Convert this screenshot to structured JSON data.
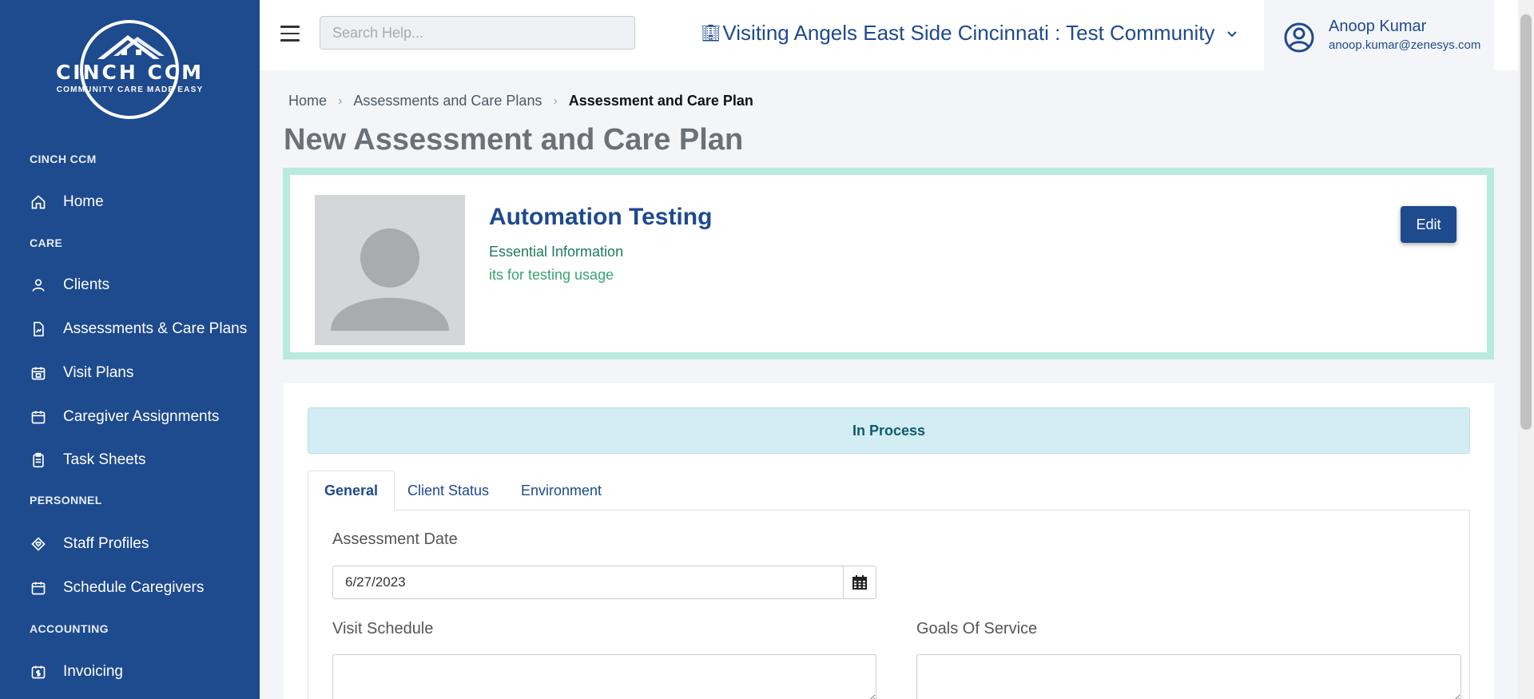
{
  "sidebar": {
    "logo_title": "CINCH CCM",
    "logo_tagline": "COMMUNITY CARE MADE EASY",
    "sections": {
      "cinch": "CINCH CCM",
      "care": "CARE",
      "personnel": "PERSONNEL",
      "accounting": "ACCOUNTING"
    },
    "items": [
      {
        "label": "Home",
        "icon": "home-icon"
      },
      {
        "label": "Clients",
        "icon": "user-icon"
      },
      {
        "label": "Assessments & Care Plans",
        "icon": "document-chart-icon"
      },
      {
        "label": "Visit Plans",
        "icon": "calendar-check-icon"
      },
      {
        "label": "Caregiver Assignments",
        "icon": "calendar-icon"
      },
      {
        "label": "Task Sheets",
        "icon": "clipboard-icon"
      },
      {
        "label": "Staff Profiles",
        "icon": "heart-badge-icon"
      },
      {
        "label": "Schedule Caregivers",
        "icon": "calendar-icon"
      },
      {
        "label": "Invoicing",
        "icon": "dollar-calendar-icon"
      }
    ]
  },
  "topbar": {
    "search_placeholder": "Search Help...",
    "organization": "Visiting Angels East Side Cincinnati : Test Community",
    "user_name": "Anoop Kumar",
    "user_email": "anoop.kumar@zenesys.com"
  },
  "breadcrumb": {
    "home": "Home",
    "parent": "Assessments and Care Plans",
    "current": "Assessment and Care Plan"
  },
  "page_title": "New Assessment and Care Plan",
  "client": {
    "name": "Automation Testing",
    "line1": "Essential Information",
    "line2": "its for testing usage",
    "edit_label": "Edit"
  },
  "status": "In Process",
  "tabs": [
    {
      "label": "General",
      "active": true
    },
    {
      "label": "Client Status",
      "active": false
    },
    {
      "label": "Environment",
      "active": false
    }
  ],
  "form": {
    "assessment_date_label": "Assessment Date",
    "assessment_date_value": "6/27/2023",
    "visit_schedule_label": "Visit Schedule",
    "goals_label": "Goals Of Service"
  },
  "colors": {
    "sidebar": "#1e4a8e",
    "accent": "#1e4a8e",
    "card_border": "#b8ebdc",
    "status_bg": "#d3edf4"
  }
}
